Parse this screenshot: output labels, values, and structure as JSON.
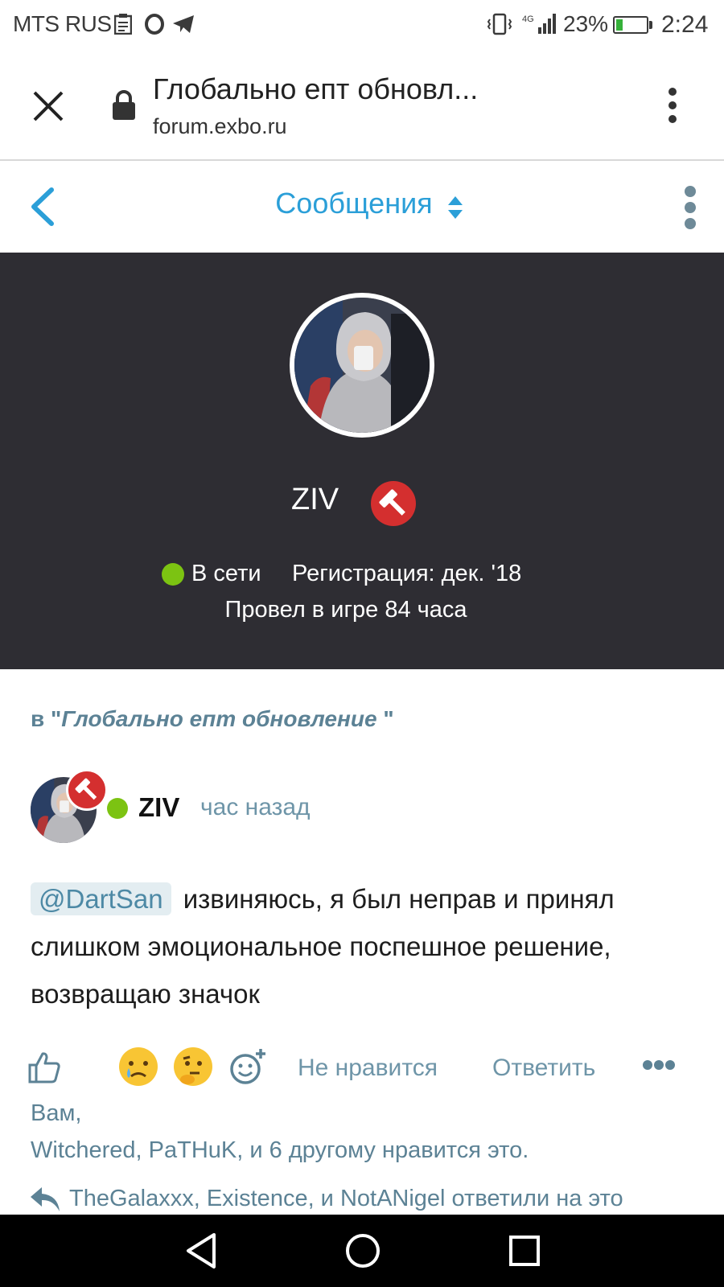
{
  "status_bar": {
    "carrier": "MTS RUS",
    "network": "4G",
    "battery": "23%",
    "battery_level": 0.23,
    "time": "2:24",
    "icons": [
      "clipboard-icon",
      "opera-icon",
      "telegram-icon",
      "vibrate-icon",
      "signal-icon",
      "battery-charging-icon"
    ]
  },
  "browser": {
    "title": "Глобально епт обновл...",
    "url": "forum.exbo.ru"
  },
  "header": {
    "title": "Сообщения"
  },
  "profile": {
    "name": "ZIV",
    "online": "В сети",
    "registered": "Регистрация: дек. '18",
    "playtime": "Провел в игре 84 часа"
  },
  "post": {
    "thread_prefix": "в \"",
    "thread_title": "Глобально епт обновление",
    "thread_suffix": " \"",
    "author": "ZIV",
    "time": "час назад",
    "mention": "@DartSan",
    "text": "извиняюсь, я был неправ и принял слишком эмоциональное поспешное решение, возвращаю значок",
    "actions": {
      "dislike": "Не нравится",
      "reply": "Ответить"
    },
    "likes_line1": "Вам,",
    "likes_line2": "Witchered, PaTHuK, и 6 другому нравится это.",
    "replies": "TheGalaxxx, Existence, и NotANigel ответили на это"
  },
  "colors": {
    "accent": "#2b9fd8",
    "banner": "#2e2d33",
    "online": "#7cc312",
    "badge": "#d42f2f",
    "muted": "#6e95a8"
  }
}
